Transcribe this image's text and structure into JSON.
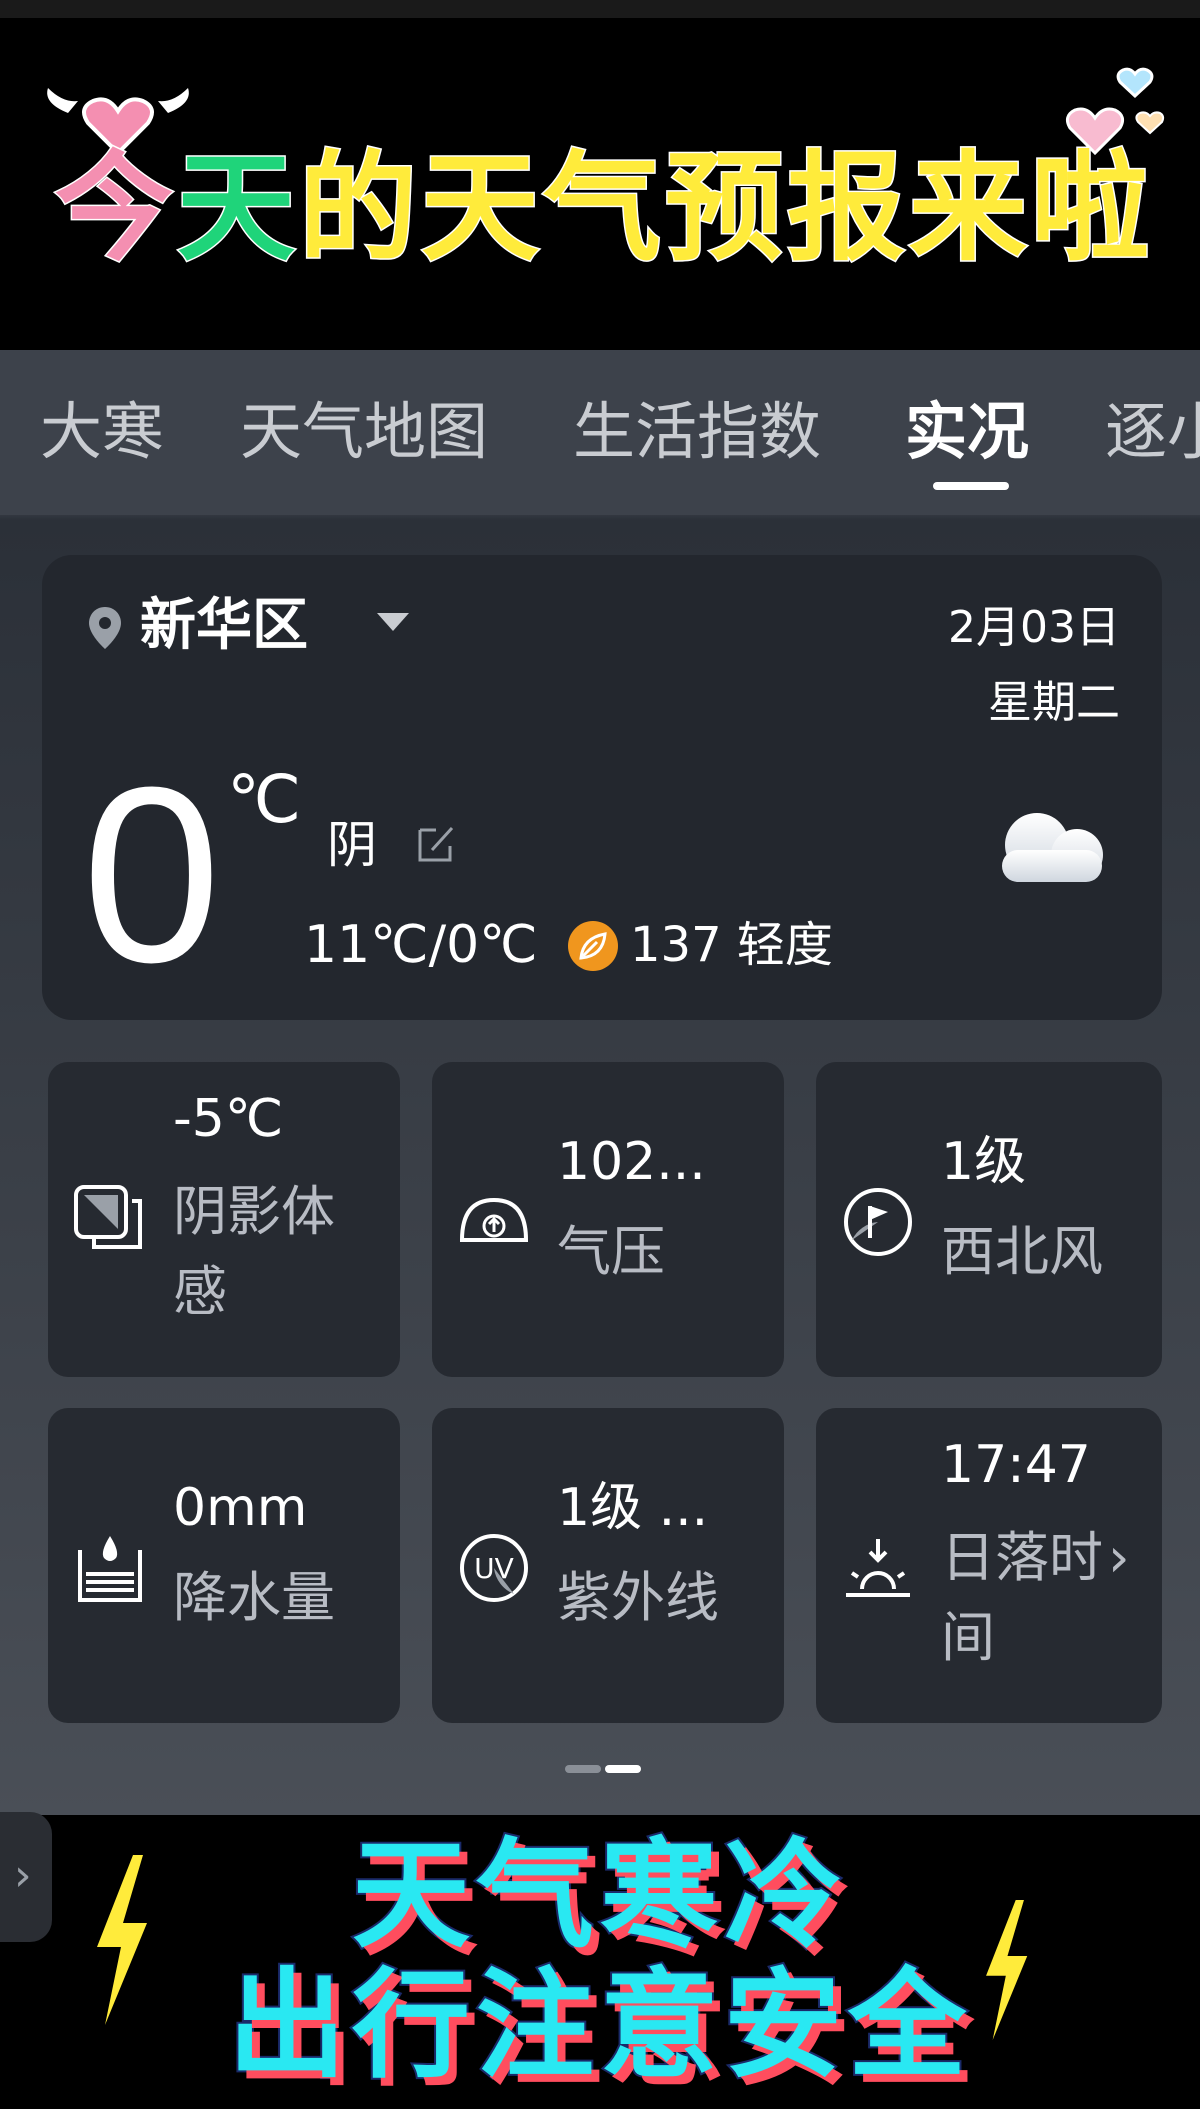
{
  "banner": {
    "title_parts": [
      "今",
      "天",
      "的天气预报来啦"
    ],
    "colors": {
      "pink": "#f48fb1",
      "green": "#1fd47a",
      "yellow": "#ffeb3b"
    }
  },
  "tabs": [
    {
      "label": "大寒",
      "active": false
    },
    {
      "label": "天气地图",
      "active": false
    },
    {
      "label": "生活指数",
      "active": false
    },
    {
      "label": "实况",
      "active": true
    },
    {
      "label": "逐小",
      "active": false
    }
  ],
  "current": {
    "location": "新华区",
    "date": "2月03日",
    "weekday": "星期二",
    "temperature": "0",
    "unit": "℃",
    "condition": "阴",
    "range": "11℃/0℃",
    "aqi": "137 轻度",
    "icons": {
      "location": "location-pin-icon",
      "edit": "edit-icon",
      "aqi": "leaf-icon",
      "weather": "cloud-icon"
    }
  },
  "details": [
    {
      "value": "-5℃",
      "label": "阴影体感",
      "icon": "feels-like-icon"
    },
    {
      "value": "102...",
      "label": "气压",
      "icon": "pressure-icon"
    },
    {
      "value": "1级",
      "label": "西北风",
      "icon": "wind-flag-icon"
    },
    {
      "value": "0mm",
      "label": "降水量",
      "icon": "precipitation-icon"
    },
    {
      "value": "1级 ...",
      "label": "紫外线",
      "icon": "uv-icon"
    },
    {
      "value": "17:47",
      "label": "日落时间",
      "icon": "sunset-icon",
      "chevron": "›"
    }
  ],
  "pager": {
    "pages": 2,
    "current": 2
  },
  "bottom_banner": {
    "line1": "天气寒冷",
    "line2": "出行注意安全",
    "colors": {
      "fill": "#29e8f2",
      "shadow": "#ff4d5e",
      "bolt": "#ffeb3b"
    }
  },
  "side_handle": "›"
}
